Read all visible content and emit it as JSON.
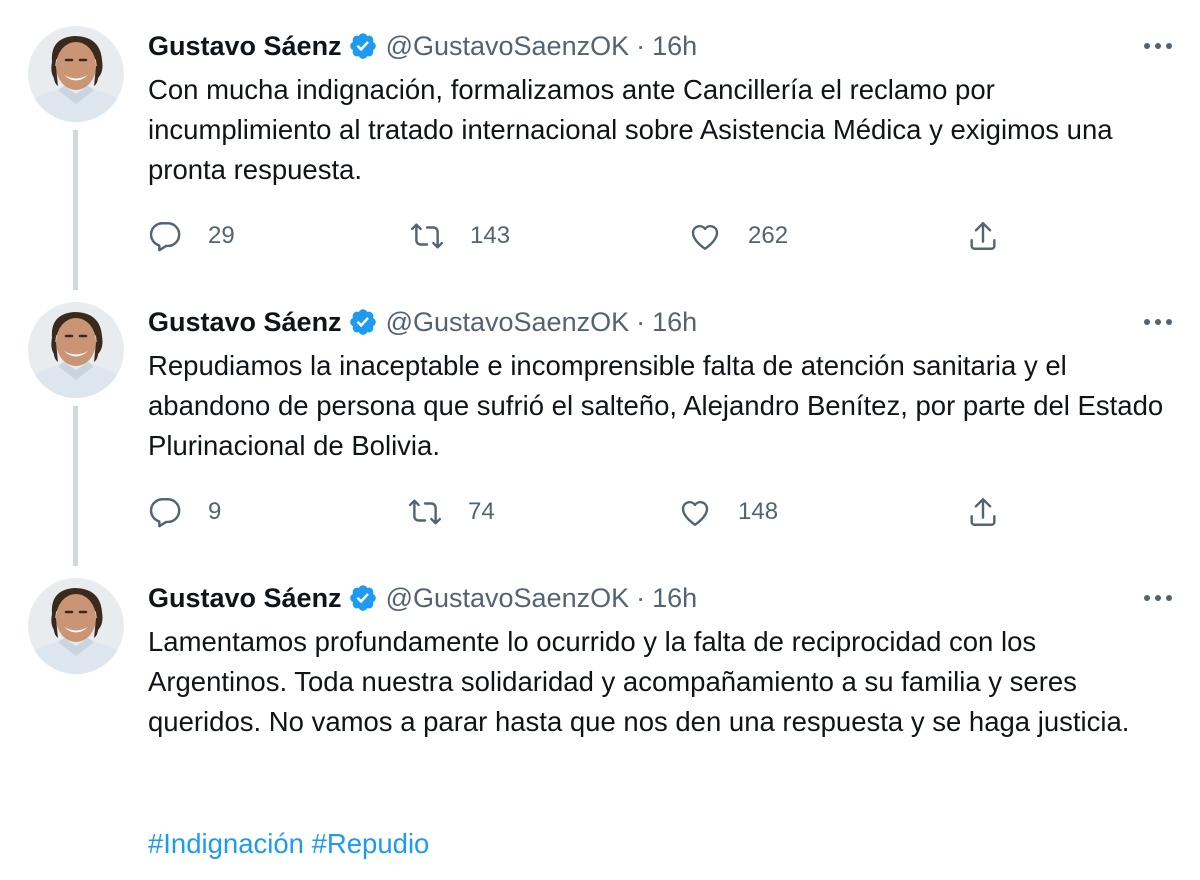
{
  "accent_color": "#1d9bf0",
  "muted_color": "#536471",
  "tweets": [
    {
      "name": "Gustavo Sáenz",
      "handle": "@GustavoSaenzOK",
      "separator": "·",
      "time": "16h",
      "text": "Con mucha indignación, formalizamos ante Cancillería el reclamo por incumplimiento al tratado internacional sobre Asistencia Médica y exigimos una pronta respuesta.",
      "replies": "29",
      "retweets": "143",
      "likes": "262"
    },
    {
      "name": "Gustavo Sáenz",
      "handle": "@GustavoSaenzOK",
      "separator": "·",
      "time": "16h",
      "text": "Repudiamos la inaceptable e incomprensible falta de atención sanitaria y el abandono de persona que sufrió el salteño, Alejandro Benítez, por parte del Estado Plurinacional de Bolivia.",
      "replies": "9",
      "retweets": "74",
      "likes": "148"
    },
    {
      "name": "Gustavo Sáenz",
      "handle": "@GustavoSaenzOK",
      "separator": "·",
      "time": "16h",
      "text": "Lamentamos profundamente lo ocurrido y la falta de reciprocidad con los Argentinos. Toda nuestra solidaridad y acompañamiento a su familia y seres queridos. No vamos a parar hasta que nos den una respuesta y se haga justicia.",
      "hashtags": [
        "#Indignación",
        "#Repudio"
      ]
    }
  ],
  "icons": {
    "avatar": "profile-photo",
    "verified": "verified-badge-icon",
    "more": "more-options-icon",
    "reply": "reply-icon",
    "retweet": "retweet-icon",
    "like": "heart-icon",
    "share": "share-icon"
  }
}
